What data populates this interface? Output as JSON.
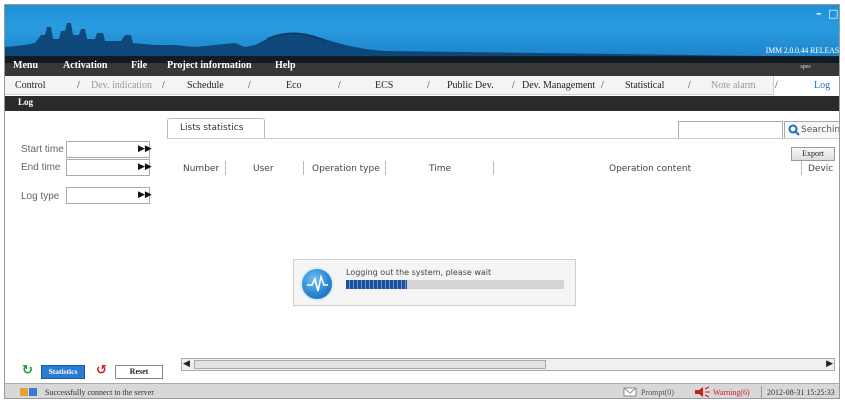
{
  "window": {
    "minimize_glyph": "–",
    "maximize_glyph": "□",
    "version": "IMM 2.0.0.44 RELEAS"
  },
  "menu": {
    "items": [
      "Menu",
      "Activation",
      "File",
      "Project information",
      "Help"
    ],
    "spec_label": "spec"
  },
  "tabs": {
    "items": [
      {
        "label": "Control",
        "state": "normal"
      },
      {
        "label": "Dev. indication",
        "state": "dim"
      },
      {
        "label": "Schedule",
        "state": "normal"
      },
      {
        "label": "Eco",
        "state": "normal"
      },
      {
        "label": "ECS",
        "state": "normal"
      },
      {
        "label": "Public Dev.",
        "state": "normal"
      },
      {
        "label": "Dev. Management",
        "state": "normal"
      },
      {
        "label": "Statistical",
        "state": "normal"
      },
      {
        "label": "Note alarm",
        "state": "dim"
      },
      {
        "label": "Log",
        "state": "active"
      }
    ],
    "separator": "/"
  },
  "section": {
    "title": "Log"
  },
  "filters": {
    "start_time_label": "Start time",
    "end_time_label": "End time",
    "log_type_label": "Log type",
    "picker_glyph": "▶▶"
  },
  "list": {
    "tab_label": "Lists statistics",
    "search_button": "Searching",
    "export_button": "Export",
    "columns": [
      "Number",
      "User",
      "Operation type",
      "Time",
      "Operation content",
      "Devic"
    ]
  },
  "dialog": {
    "message": "Logging out the system, please wait",
    "progress": 0.28
  },
  "buttons": {
    "statistics": "Statistics",
    "reset": "Reset"
  },
  "status": {
    "message": "Successfully connect to the server",
    "prompt": "Prompt(0)",
    "warning": "Warning(6)",
    "timestamp": "2012-08-31 15:25:33"
  },
  "colors": {
    "banner": "#1e8fd6",
    "accent": "#2a7bd4",
    "warning": "#c42020"
  }
}
